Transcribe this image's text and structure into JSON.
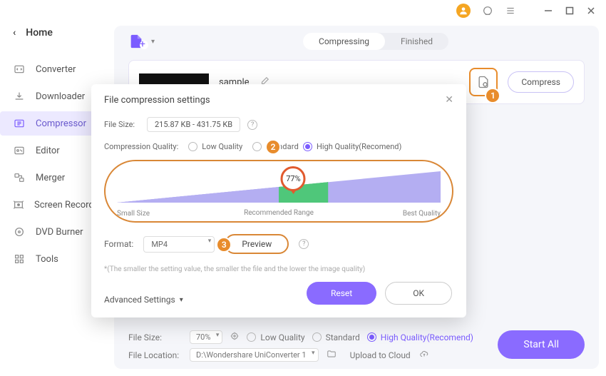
{
  "titlebar": {
    "avatar_initial": "",
    "support_icon": "support-icon",
    "menu_icon": "menu-icon"
  },
  "sidebar": {
    "home_label": "Home",
    "items": [
      {
        "icon": "↻",
        "label": "Converter"
      },
      {
        "icon": "↓",
        "label": "Downloader"
      },
      {
        "icon": "▭",
        "label": "Compressor"
      },
      {
        "icon": "✎",
        "label": "Editor"
      },
      {
        "icon": "⧉",
        "label": "Merger"
      },
      {
        "icon": "⌖",
        "label": "Screen Recorder"
      },
      {
        "icon": "◎",
        "label": "DVD Burner"
      },
      {
        "icon": "⌗",
        "label": "Tools"
      }
    ]
  },
  "main": {
    "tabs": [
      {
        "label": "Compressing",
        "active": true
      },
      {
        "label": "Finished",
        "active": false
      }
    ],
    "file": {
      "name": "sample"
    },
    "compress_button": "Compress"
  },
  "modal": {
    "title": "File compression settings",
    "file_size": {
      "label": "File Size:",
      "value": "215.87 KB - 431.75 KB"
    },
    "quality": {
      "label": "Compression Quality:",
      "options": [
        "Low Quality",
        "Standard",
        "High Quality(Recomend)"
      ]
    },
    "slider": {
      "value_text": "77%",
      "left": "Small Size",
      "center": "Recommended Range",
      "right": "Best Quality"
    },
    "format": {
      "label": "Format:",
      "value": "MP4"
    },
    "preview": "Preview",
    "hint": "*(The smaller the setting value, the smaller the file and the lower the image quality)",
    "advanced": "Advanced Settings",
    "reset": "Reset",
    "ok": "OK",
    "badges": {
      "one": "1",
      "two": "2",
      "three": "3"
    }
  },
  "bottom": {
    "file_size_label": "File Size:",
    "file_size_value": "70%",
    "quality_low": "Low Quality",
    "quality_standard": "Standard",
    "quality_high": "High Quality(Recomend)",
    "location_label": "File Location:",
    "location_value": "D:\\Wondershare UniConverter 1",
    "upload_label": "Upload to Cloud",
    "start_all": "Start All"
  }
}
